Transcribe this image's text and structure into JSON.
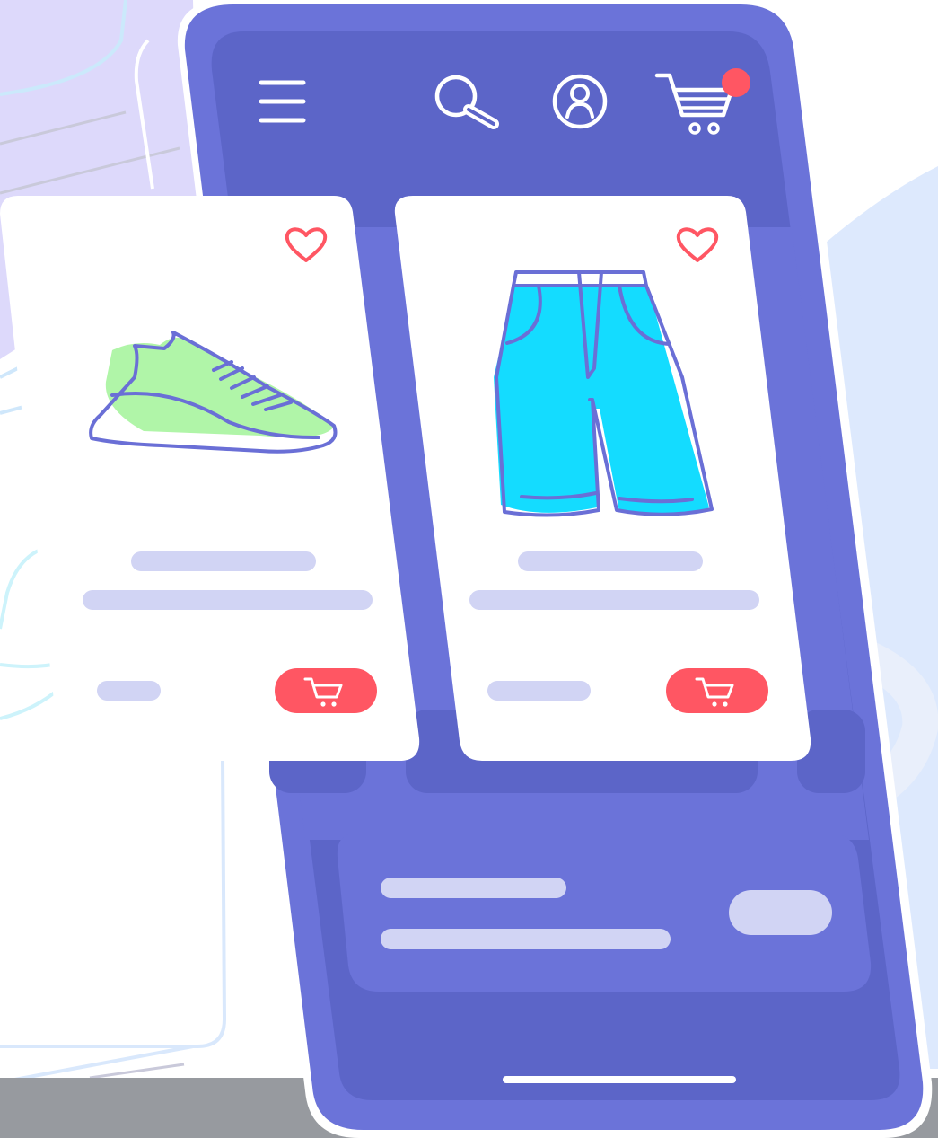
{
  "colors": {
    "phone_body": "#6b73d9",
    "phone_screen": "#5c65c8",
    "card": "#ffffff",
    "outline": "#6a6fd6",
    "placeholder": "#d1d4f4",
    "accent_red": "#ff5663",
    "sneaker_fill": "#b0f5a8",
    "shorts_fill": "#14dcff",
    "bg_lavender": "#ddd9fb",
    "bg_light_blue": "#dde9fd",
    "floor_gray": "#979a9f"
  },
  "icons": {
    "menu": "hamburger-menu",
    "search": "magnifier",
    "account": "user-circle",
    "cart": "shopping-cart",
    "notification": "red-dot-badge",
    "favorite": "heart-outline",
    "add_to_cart": "cart"
  },
  "products": [
    {
      "image": "green-sneaker",
      "favorite": false
    },
    {
      "image": "cyan-shorts",
      "favorite": false
    }
  ]
}
